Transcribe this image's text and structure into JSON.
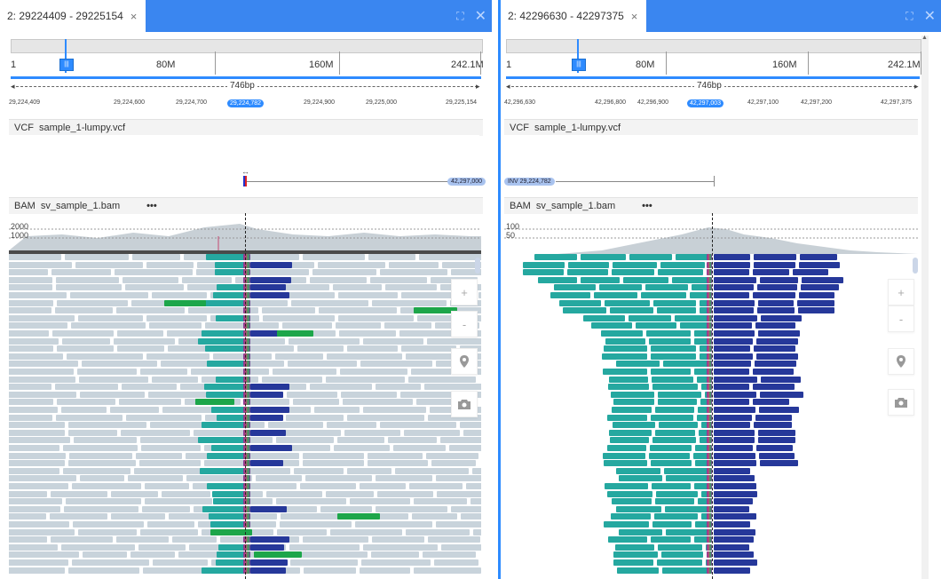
{
  "panels": [
    {
      "tab_title": "2: 29224409 - 29225154",
      "tab_close": "×",
      "ruler": {
        "start": "1",
        "mid1": "80M",
        "mid2": "160M",
        "end": "242.1M"
      },
      "span": "746bp",
      "ticks": [
        "29,224,409",
        "29,224,600",
        "29,224,700",
        "29,224,782",
        "29,224,900",
        "29,225,000",
        "29,225,154"
      ],
      "vcf_header": {
        "type": "VCF",
        "file": "sample_1-lumpy.vcf"
      },
      "vcf_pill": "42,297,000",
      "bam_header": {
        "type": "BAM",
        "file": "sv_sample_1.bam",
        "menu": "•••"
      },
      "coverage_labels": [
        "2000",
        "1000"
      ]
    },
    {
      "tab_title": "2: 42296630 - 42297375",
      "tab_close": "×",
      "ruler": {
        "start": "1",
        "mid1": "80M",
        "mid2": "160M",
        "end": "242.1M"
      },
      "span": "746bp",
      "ticks": [
        "42,296,630",
        "42,296,800",
        "42,296,900",
        "42,297,003",
        "42,297,100",
        "42,297,200",
        "42,297,375"
      ],
      "vcf_header": {
        "type": "VCF",
        "file": "sample_1-lumpy.vcf"
      },
      "vcf_pill": "INV 29,224,782",
      "bam_header": {
        "type": "BAM",
        "file": "sv_sample_1.bam",
        "menu": "•••"
      },
      "coverage_labels": [
        "100",
        "50"
      ]
    }
  ],
  "controls": {
    "zoom_in": "+",
    "zoom_out": "-"
  },
  "icons": {
    "maximize": "maximize-icon",
    "close": "close-icon",
    "location": "location-pin-icon",
    "camera": "camera-icon"
  },
  "colors": {
    "accent": "#3a86f0",
    "gray_read": "#c8d3db",
    "teal_read": "#25a8a0",
    "navy_read": "#26389a",
    "green_read": "#1da64a"
  }
}
